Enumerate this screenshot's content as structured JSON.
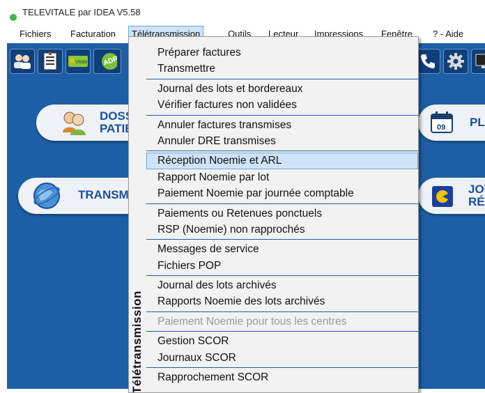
{
  "window": {
    "title": "TELEVITALE par IDEA V5.58"
  },
  "menubar": {
    "items": [
      {
        "label": "Fichiers"
      },
      {
        "label": "Facturation"
      },
      {
        "label": "Télétransmission"
      },
      {
        "label": "Outils"
      },
      {
        "label": "Lecteur"
      },
      {
        "label": "Impressions"
      },
      {
        "label": "Fenêtre"
      },
      {
        "label": "? - Aide"
      }
    ]
  },
  "toolbar": {
    "icons": [
      "patients-icon",
      "document-icon",
      "vitale-card-icon",
      "adri-icon",
      "phone-icon",
      "gear-icon",
      "monitor-icon"
    ],
    "vitale_text": "Vitale",
    "adri_text": "ADRi"
  },
  "panels": {
    "dossiers_line1": "DOSS",
    "dossiers_line2": "PATIE",
    "transmission": "TRANSM",
    "planning_text": "PL",
    "calendar_day": "09",
    "journal_line1": "JOU",
    "journal_line2": "RÉG"
  },
  "dropdown": {
    "side_label": "Télétransmission",
    "groups": [
      [
        {
          "label": "Préparer factures"
        },
        {
          "label": "Transmettre"
        }
      ],
      [
        {
          "label": "Journal des lots et bordereaux"
        },
        {
          "label": "Vérifier factures non validées"
        }
      ],
      [
        {
          "label": "Annuler factures transmises"
        },
        {
          "label": "Annuler DRE transmises"
        }
      ],
      [
        {
          "label": "Réception Noemie et ARL"
        },
        {
          "label": "Rapport Noemie par lot"
        },
        {
          "label": "Paiement Noemie par journée comptable"
        }
      ],
      [
        {
          "label": "Paiements ou Retenues ponctuels"
        },
        {
          "label": "RSP (Noemie) non rapprochés"
        }
      ],
      [
        {
          "label": "Messages de service"
        },
        {
          "label": "Fichiers POP"
        }
      ],
      [
        {
          "label": "Journal des lots archivés"
        },
        {
          "label": "Rapports Noemie des lots archivés"
        }
      ],
      [
        {
          "label": "Paiement Noemie pour tous les centres",
          "disabled": true
        }
      ],
      [
        {
          "label": "Gestion SCOR"
        },
        {
          "label": "Journaux SCOR"
        }
      ],
      [
        {
          "label": "Rapprochement SCOR"
        }
      ]
    ],
    "highlighted": "Réception Noemie et ARL"
  },
  "colors": {
    "background": "#1d5fa6",
    "highlight": "#cfe3f7",
    "separator": "#1d5fa6",
    "disabled_text": "#9a9a9a"
  }
}
